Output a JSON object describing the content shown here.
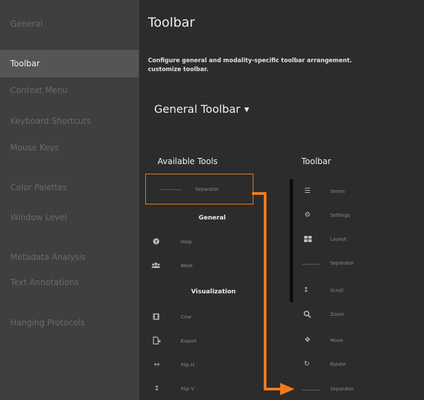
{
  "sidebar": {
    "items": [
      {
        "label": "General",
        "active": false
      },
      {
        "label": "Toolbar",
        "active": true
      },
      {
        "label": "Context Menu",
        "active": false
      },
      {
        "label": "Keyboard Shortcuts",
        "active": false
      },
      {
        "label": "Mouse Keys",
        "active": false
      },
      {
        "label": "Color Palettes",
        "active": false
      },
      {
        "label": "Window Level",
        "active": false
      },
      {
        "label": "Metadata Analysis",
        "active": false
      },
      {
        "label": "Text Annotations",
        "active": false
      },
      {
        "label": "Hanging Protocols",
        "active": false
      }
    ]
  },
  "main": {
    "title": "Toolbar",
    "description_line1": "Configure general and modality-specific toolbar arrangement.",
    "description_line2": "customize toolbar.",
    "dropdown_label": "General Toolbar",
    "available_tools_heading": "Available Tools",
    "toolbar_heading": "Toolbar",
    "available": {
      "separator_label": "Separator",
      "general_heading": "General",
      "general_tools": [
        {
          "label": "Help",
          "icon": "help-icon"
        },
        {
          "label": "Meet",
          "icon": "meet-icon"
        }
      ],
      "visualization_heading": "Visualization",
      "visualization_tools": [
        {
          "label": "Cine",
          "icon": "cine-icon"
        },
        {
          "label": "Export",
          "icon": "export-icon"
        },
        {
          "label": "Flip H",
          "icon": "flip-h-icon"
        },
        {
          "label": "Flip V",
          "icon": "flip-v-icon"
        }
      ]
    },
    "toolbar_tools": [
      {
        "label": "Series",
        "icon": "series-icon"
      },
      {
        "label": "Settings",
        "icon": "settings-icon"
      },
      {
        "label": "Layout",
        "icon": "layout-icon"
      },
      {
        "label": "Separator",
        "icon": "separator-line"
      },
      {
        "label": "Scroll",
        "icon": "scroll-icon"
      },
      {
        "label": "Zoom",
        "icon": "zoom-icon"
      },
      {
        "label": "Move",
        "icon": "move-icon"
      },
      {
        "label": "Rotate",
        "icon": "rotate-icon"
      },
      {
        "label": "Separator",
        "icon": "separator-line"
      }
    ]
  },
  "colors": {
    "accent": "#f07b1a",
    "sidebar_bg": "#3f3f3f",
    "sidebar_active_bg": "#555555",
    "main_bg": "#2c2c2c"
  }
}
